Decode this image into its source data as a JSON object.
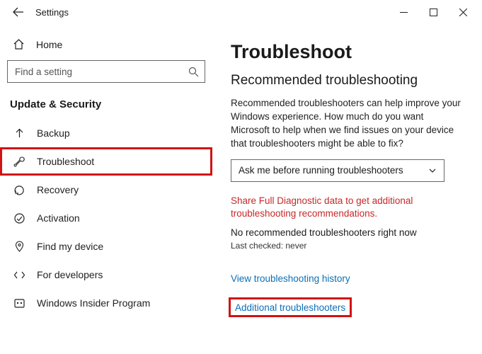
{
  "window": {
    "title": "Settings"
  },
  "sidebar": {
    "home_label": "Home",
    "search_placeholder": "Find a setting",
    "section": "Update & Security",
    "items": [
      {
        "label": "Backup"
      },
      {
        "label": "Troubleshoot"
      },
      {
        "label": "Recovery"
      },
      {
        "label": "Activation"
      },
      {
        "label": "Find my device"
      },
      {
        "label": "For developers"
      },
      {
        "label": "Windows Insider Program"
      }
    ]
  },
  "main": {
    "h1": "Troubleshoot",
    "h2": "Recommended troubleshooting",
    "para": "Recommended troubleshooters can help improve your Windows experience. How much do you want Microsoft to help when we find issues on your device that troubleshooters might be able to fix?",
    "dropdown_value": "Ask me before running troubleshooters",
    "share_diag": "Share Full Diagnostic data to get additional troubleshooting recommendations.",
    "no_rec": "No recommended troubleshooters right now",
    "last_checked": "Last checked: never",
    "history_link": "View troubleshooting history",
    "additional_link": "Additional troubleshooters"
  }
}
